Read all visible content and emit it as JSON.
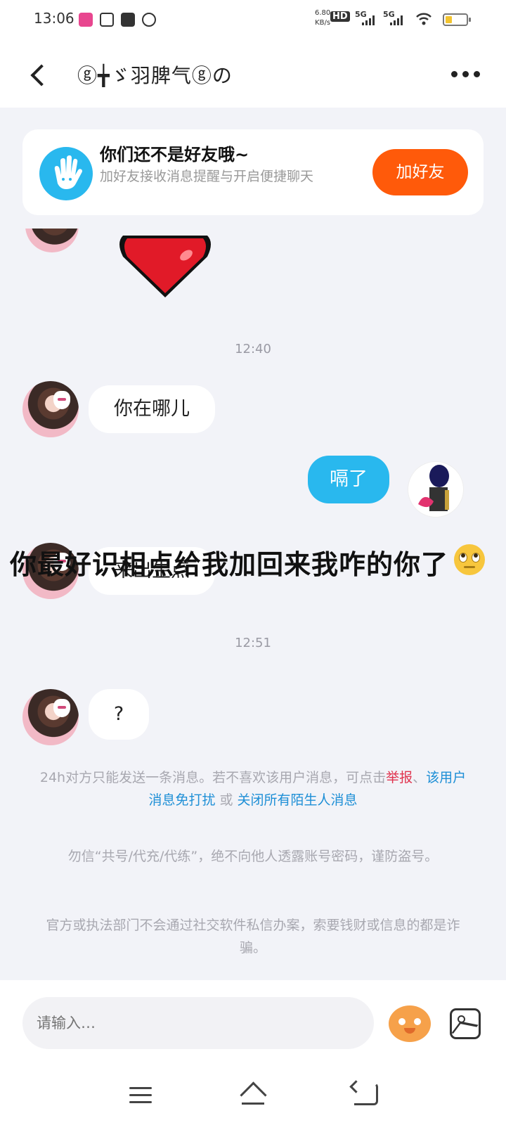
{
  "status_bar": {
    "time": "13:06",
    "net_speed_value": "6.80",
    "net_speed_unit": "KB/s",
    "hd_label": "HD",
    "sim1_label": "5G",
    "sim2_label": "5G",
    "battery_level": 0.2
  },
  "header": {
    "title": "ⓖ╈ゞ羽脾气ⓖの"
  },
  "friend_banner": {
    "title": "你们还不是好友哦~",
    "description": "加好友接收消息提醒与开启便捷聊天",
    "add_button": "加好友"
  },
  "messages": {
    "time_1": "12:40",
    "msg_1": "你在哪儿",
    "reply_1": "嗝了",
    "msg_2": "来出生点",
    "time_2": "12:51",
    "msg_3": "?"
  },
  "overlay": {
    "caption": "你最好识相点给我加回来我咋的你了"
  },
  "notices": {
    "limit_text": "24h对方只能发送一条消息。若不喜欢该用户消息，可点击",
    "report_link": "举报",
    "sep_1": "、",
    "mute_link": "该用户消息免打扰",
    "or_text": " 或 ",
    "close_link": "关闭所有陌生人消息",
    "warning_1": "勿信“共号/代充/代练”，绝不向他人透露账号密码，谨防盗号。",
    "warning_2": "官方或执法部门不会通过社交软件私信办案，索要钱财或信息的都是诈骗。"
  },
  "input_bar": {
    "placeholder": "请输入…"
  },
  "colors": {
    "accent_blue": "#29b8ee",
    "add_button": "#ff5a0a",
    "report_red": "#e0334e",
    "link_blue": "#1e8fd6"
  }
}
